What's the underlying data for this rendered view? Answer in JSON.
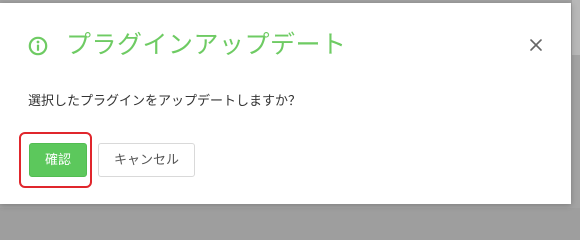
{
  "dialog": {
    "title": "プラグインアップデート",
    "message": "選択したプラグインをアップデートしますか？",
    "title_icon": "info-circle-icon",
    "close_icon": "close-icon",
    "confirm_label": "確認",
    "cancel_label": "キャンセル"
  },
  "colors": {
    "accent": "#6ecb63",
    "primary_button": "#5cc85c",
    "highlight": "#e0262c"
  }
}
